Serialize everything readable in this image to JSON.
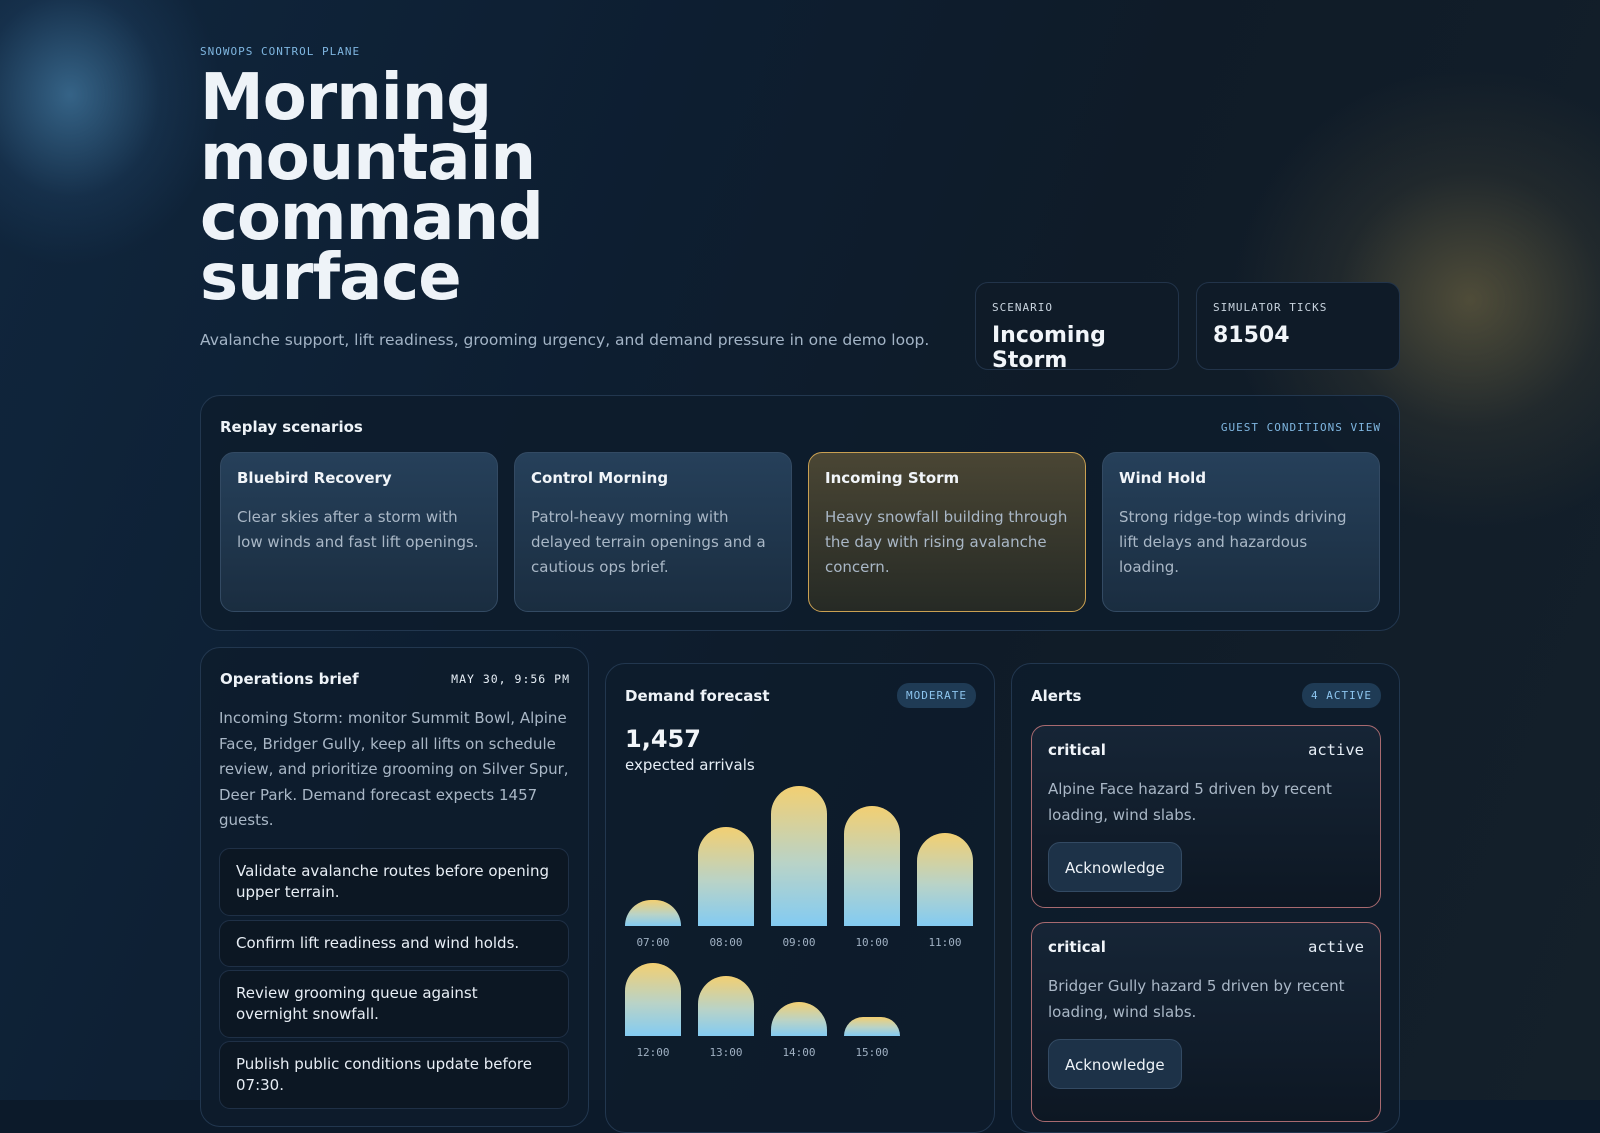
{
  "hero": {
    "eyebrow": "SNOWOPS CONTROL PLANE",
    "title": "Morning mountain command surface",
    "subtitle": "Avalanche support, lift readiness, grooming urgency, and demand pressure in one demo loop."
  },
  "stats": {
    "scenario_label": "SCENARIO",
    "scenario_value": "Incoming Storm",
    "ticks_label": "SIMULATOR TICKS",
    "ticks_value": "81504"
  },
  "replay": {
    "title": "Replay scenarios",
    "link": "GUEST CONDITIONS VIEW",
    "scenarios": [
      {
        "name": "Bluebird Recovery",
        "desc": "Clear skies after a storm with low winds and fast lift openings.",
        "selected": false
      },
      {
        "name": "Control Morning",
        "desc": "Patrol-heavy morning with delayed terrain openings and a cautious ops brief.",
        "selected": false
      },
      {
        "name": "Incoming Storm",
        "desc": "Heavy snowfall building through the day with rising avalanche concern.",
        "selected": true
      },
      {
        "name": "Wind Hold",
        "desc": "Strong ridge-top winds driving lift delays and hazardous loading.",
        "selected": false
      }
    ]
  },
  "ops": {
    "title": "Operations brief",
    "date": "MAY 30, 9:56 PM",
    "summary": "Incoming Storm: monitor Summit Bowl, Alpine Face, Bridger Gully, keep all lifts on schedule review, and prioritize grooming on Silver Spur, Deer Park. Demand forecast expects 1457 guests.",
    "tasks": [
      "Validate avalanche routes before opening upper terrain.",
      "Confirm lift readiness and wind holds.",
      "Review grooming queue against overnight snowfall.",
      "Publish public conditions update before 07:30."
    ]
  },
  "demand": {
    "title": "Demand forecast",
    "badge": "MODERATE",
    "total": "1,457",
    "total_label": "expected arrivals"
  },
  "chart_data": {
    "type": "bar",
    "categories": [
      "07:00",
      "08:00",
      "09:00",
      "10:00",
      "11:00",
      "12:00",
      "13:00",
      "14:00",
      "15:00"
    ],
    "values": [
      42,
      160,
      226,
      193,
      150,
      118,
      97,
      55,
      31
    ],
    "colors": {
      "top": "#f2cf72",
      "bottom": "#83cbf2"
    }
  },
  "alerts": {
    "title": "Alerts",
    "badge": "4 ACTIVE",
    "items": [
      {
        "severity": "critical",
        "status": "active",
        "message": "Alpine Face hazard 5 driven by recent loading, wind slabs.",
        "action": "Acknowledge"
      },
      {
        "severity": "critical",
        "status": "active",
        "message": "Bridger Gully hazard 5 driven by recent loading, wind slabs.",
        "action": "Acknowledge"
      }
    ]
  },
  "colors": {
    "accent": "#7fb6e0",
    "selected_border": "#c9a052",
    "alert_border": "#a86a70",
    "background": "#0c1a2a"
  }
}
